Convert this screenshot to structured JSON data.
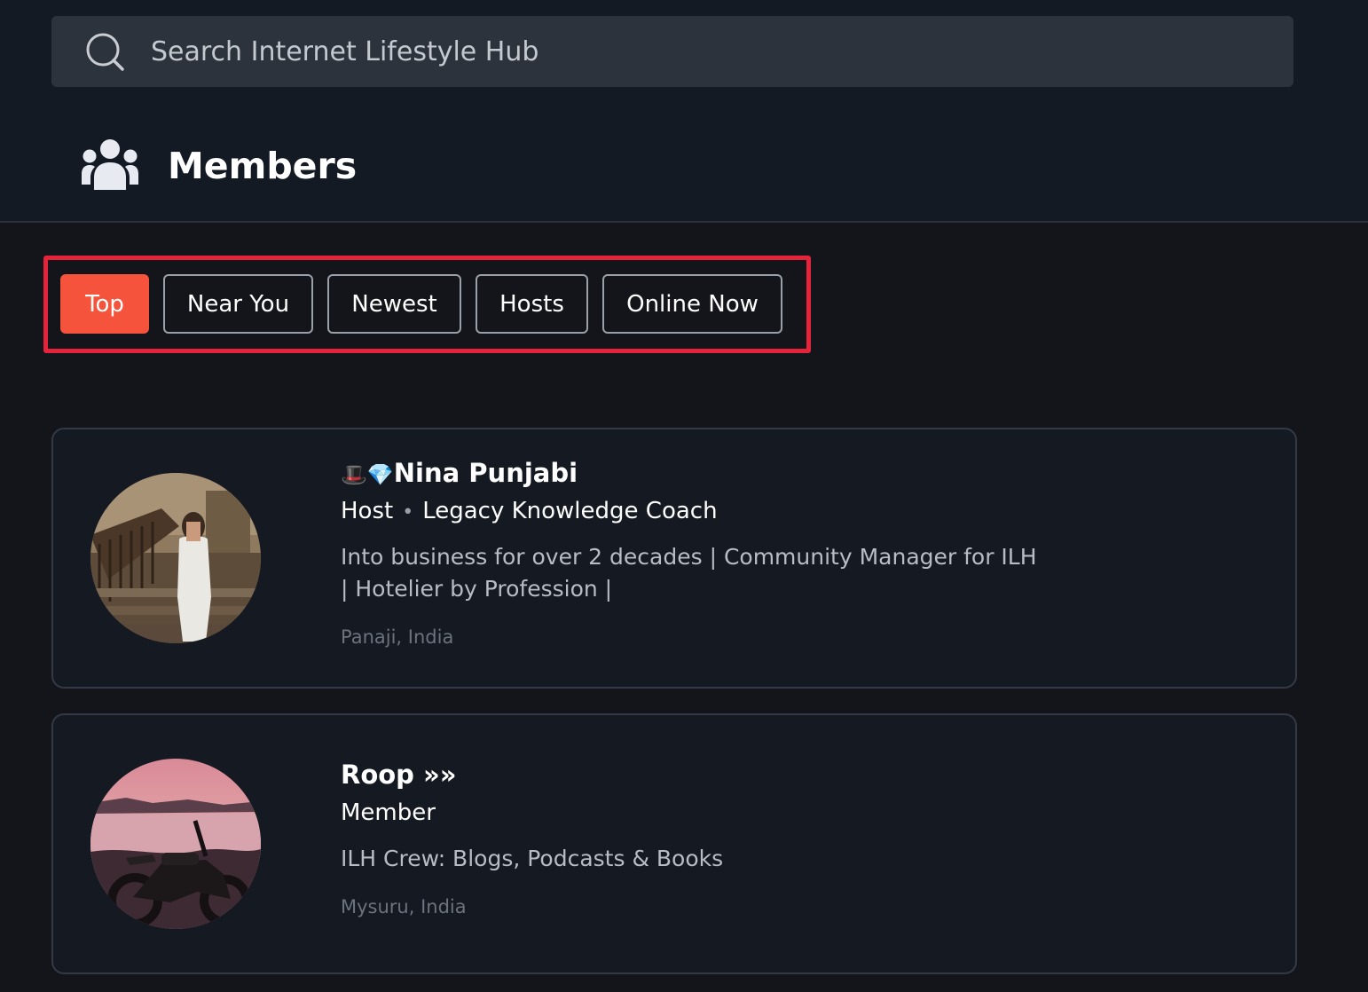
{
  "search": {
    "placeholder": "Search Internet Lifestyle Hub",
    "value": ""
  },
  "header": {
    "title": "Members",
    "icon": "members-icon"
  },
  "filters": [
    {
      "label": "Top",
      "active": true
    },
    {
      "label": "Near You",
      "active": false
    },
    {
      "label": "Newest",
      "active": false
    },
    {
      "label": "Hosts",
      "active": false
    },
    {
      "label": "Online Now",
      "active": false
    }
  ],
  "members": [
    {
      "name_prefix": "🎩💎",
      "name": "Nina Punjabi",
      "role": "Host",
      "title": "Legacy Knowledge Coach",
      "bio": "Into business for over 2 decades | Community Manager for ILH | Hotelier by Profession |",
      "location": "Panaji, India"
    },
    {
      "name_prefix": "",
      "name": "Roop »»",
      "role": "Member",
      "title": "",
      "bio": "ILH Crew: Blogs, Podcasts & Books",
      "location": "Mysuru, India"
    }
  ],
  "colors": {
    "accent": "#f5533b",
    "highlight": "#e5243b",
    "background": "#14151b"
  }
}
